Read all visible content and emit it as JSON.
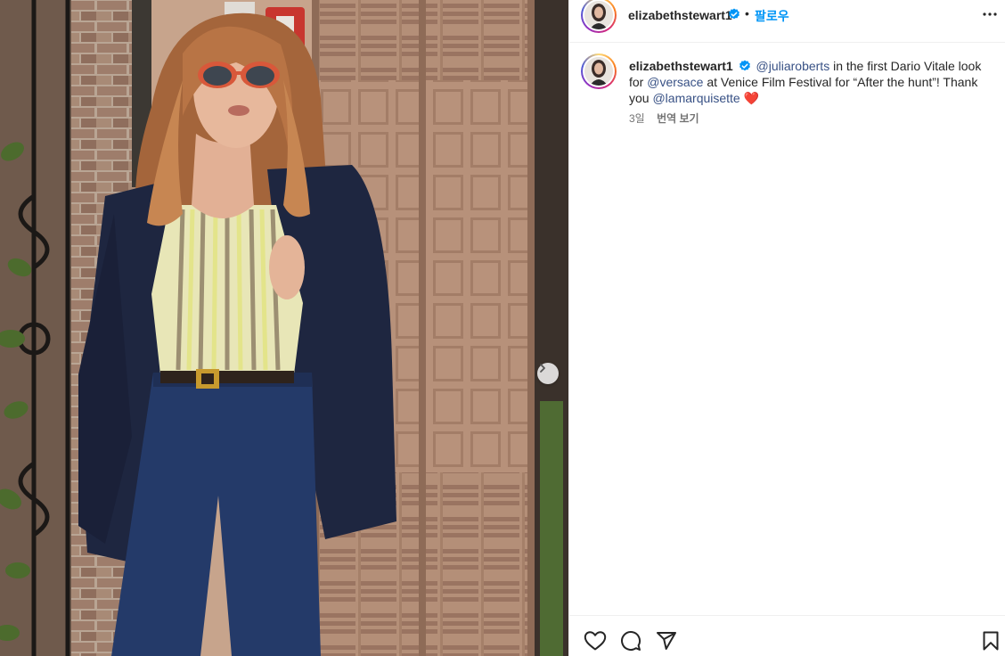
{
  "post": {
    "author": "elizabethstewart1",
    "verified": true,
    "separator": "•",
    "follow_label": "팔로우"
  },
  "caption": {
    "author": "elizabethstewart1",
    "mention1": "@juliaroberts",
    "text1": " in the first Dario Vitale look for ",
    "mention2": "@versace",
    "text2": " at Venice Film Festival for “After the hunt”! Thank you ",
    "mention3": "@lamarquisette",
    "emoji": "❤️",
    "time_ago": "3일",
    "translate_label": "번역 보기"
  },
  "icons": {
    "more": "more-options-icon",
    "like": "heart-icon",
    "comment": "comment-icon",
    "share": "send-icon",
    "save": "bookmark-icon",
    "next": "chevron-right-icon",
    "verified": "verified-badge-icon"
  },
  "colors": {
    "accent": "#0095f6",
    "mention": "#385185",
    "heart_emoji": "#e0245e"
  }
}
